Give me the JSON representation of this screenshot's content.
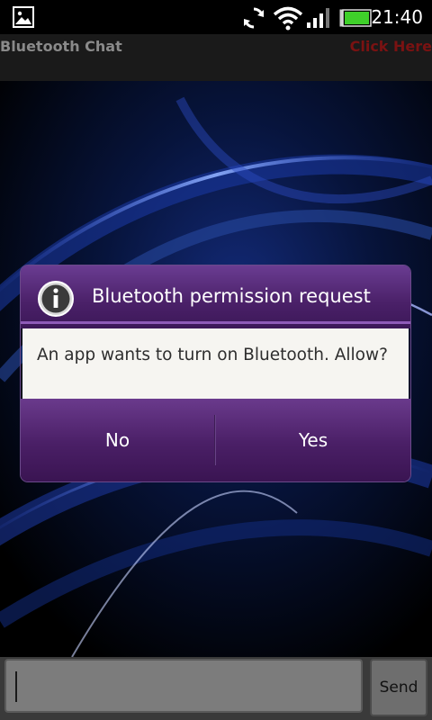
{
  "status_bar": {
    "time": "21:40",
    "icons": [
      "image-icon",
      "sync-icon",
      "wifi-icon",
      "signal-icon",
      "battery-icon"
    ]
  },
  "app": {
    "title": "Bluetooth Chat",
    "action_link": "Click Here"
  },
  "dialog": {
    "title": "Bluetooth permission request",
    "message": "An app wants to turn on Bluetooth. Allow?",
    "no_label": "No",
    "yes_label": "Yes",
    "accent_color": "#4a2068"
  },
  "composer": {
    "input_value": "",
    "send_label": "Send"
  }
}
